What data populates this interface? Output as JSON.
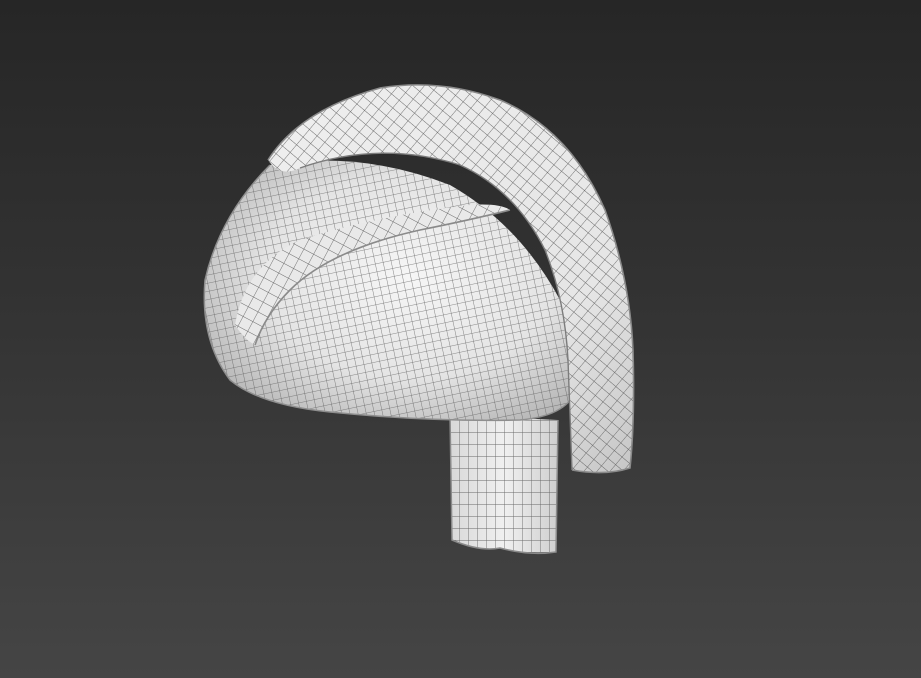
{
  "viewport": {
    "background_top": "#262626",
    "background_bottom": "#454545",
    "object_icon": "turban-wireframe-mesh",
    "mesh_color": "#f2f2f2",
    "wire_color": "#555555",
    "shade_color": "#b8b8b8"
  }
}
